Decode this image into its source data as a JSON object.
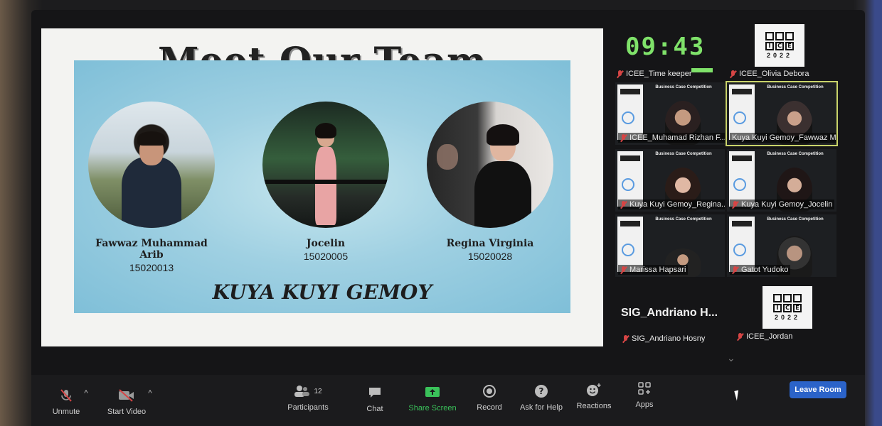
{
  "slide": {
    "title": "Meet Our Team",
    "team_name": "KUYA KUYI GEMOY",
    "members": [
      {
        "name": "Fawwaz Muhammad Arib",
        "id": "15020013"
      },
      {
        "name": "Jocelin",
        "id": "15020005"
      },
      {
        "name": "Regina Virginia",
        "id": "15020028"
      }
    ]
  },
  "timer": {
    "value": "09:43"
  },
  "logo": {
    "letters": [
      "I",
      "C",
      "E",
      "E"
    ],
    "year": "2022"
  },
  "participants_panel": {
    "timekeeper": "ICEE_Time keeper",
    "olivia": "ICEE_Olivia Debora",
    "video_tiles": [
      {
        "name": "ICEE_Muhamad Rizhan F...",
        "banner": "Business Case Competition"
      },
      {
        "name": "Kuya Kuyi Gemoy_Fawwaz M...",
        "banner": "Business Case Competition"
      },
      {
        "name": "Kuya Kuyi Gemoy_Regina...",
        "banner": "Business Case Competition"
      },
      {
        "name": "Kuya Kuyi Gemoy_Jocelin",
        "banner": "Business Case Competition"
      },
      {
        "name": "Marissa Hapsari",
        "banner": "Business Case Competition"
      },
      {
        "name": "Gatot Yudoko",
        "banner": "Business Case Competition"
      }
    ],
    "big_name": "SIG_Andriano  H...",
    "andriano": "SIG_Andriano Hosny",
    "jordan": "ICEE_Jordan"
  },
  "toolbar": {
    "unmute": "Unmute",
    "start_video": "Start Video",
    "participants": "Participants",
    "participants_count": "12",
    "chat": "Chat",
    "share_screen": "Share Screen",
    "record": "Record",
    "ask_help": "Ask for Help",
    "reactions": "Reactions",
    "apps": "Apps",
    "leave": "Leave Room"
  },
  "colors": {
    "timer": "#7fe26a",
    "share": "#3ac25a",
    "leave": "#2b63c9",
    "mic_off": "#d64545"
  }
}
